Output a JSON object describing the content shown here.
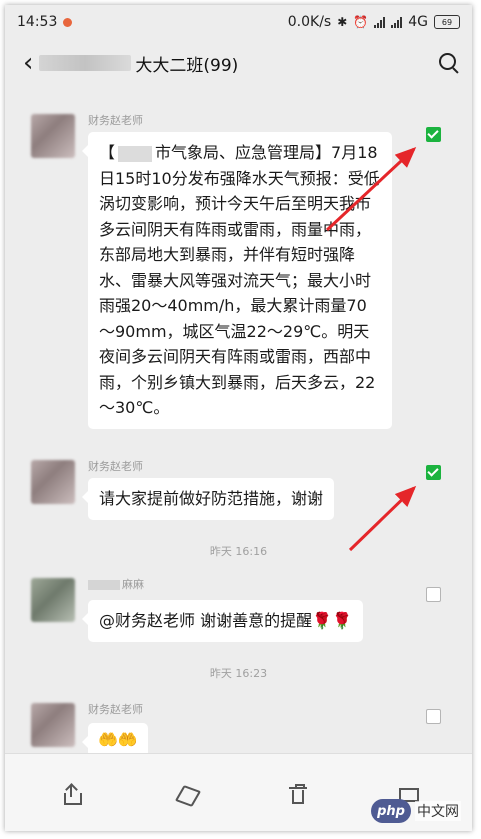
{
  "status_bar": {
    "time": "14:53",
    "net_speed": "0.0K/s",
    "network_type": "4G",
    "battery": "69"
  },
  "header": {
    "title": "大大二班(99)"
  },
  "messages": [
    {
      "sender": "财务赵老师",
      "text_before_redaction": "【",
      "text_after_redaction": "市气象局、应急管理局】7月18日15时10分发布强降水天气预报：受低涡切变影响，预计今天午后至明天我市多云间阴天有阵雨或雷雨，雨量中雨，东部局地大到暴雨，并伴有短时强降水、雷暴大风等强对流天气；最大小时雨强20～40mm/h，最大累计雨量70～90mm，城区气温22～29℃。明天夜间多云间阴天有阵雨或雷雨，西部中雨，个别乡镇大到暴雨，后天多云，22～30℃。",
      "selected": true
    },
    {
      "sender": "财务赵老师",
      "text": "请大家提前做好防范措施，谢谢",
      "selected": true
    },
    {
      "sender": "麻麻",
      "text": "@财务赵老师  谢谢善意的提醒🌹🌹",
      "selected": false
    },
    {
      "sender": "财务赵老师",
      "text": "🤲🤲",
      "selected": false
    }
  ],
  "timestamps": [
    "昨天 16:16",
    "昨天 16:23"
  ],
  "colors": {
    "checkbox_checked": "#1bb33f",
    "annotation_arrow": "#e5262a",
    "chat_background": "#ededed"
  },
  "watermark": {
    "logo_text": "php",
    "site_text": "中文网"
  }
}
